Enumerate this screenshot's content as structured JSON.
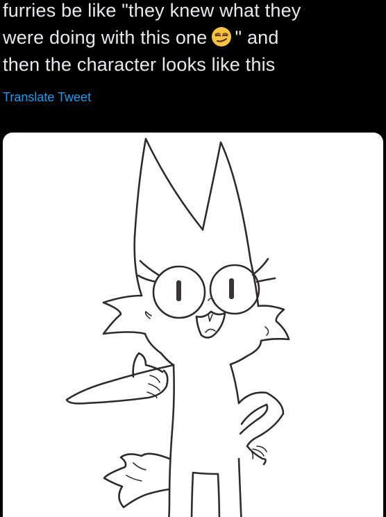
{
  "tweet": {
    "text_lines": [
      "furries be like \"they knew what they",
      "were doing with this one",
      "\" and",
      "then the character looks like this"
    ],
    "emoji": "smirking-face-emoji",
    "translate_label": "Translate Tweet"
  },
  "colors": {
    "background": "#000000",
    "text": "#e7e9ea",
    "link": "#1d9bf0",
    "media_background": "#ffffff",
    "ink": "#2e2a2c"
  },
  "media": {
    "subject": "fox-character-drawing"
  }
}
